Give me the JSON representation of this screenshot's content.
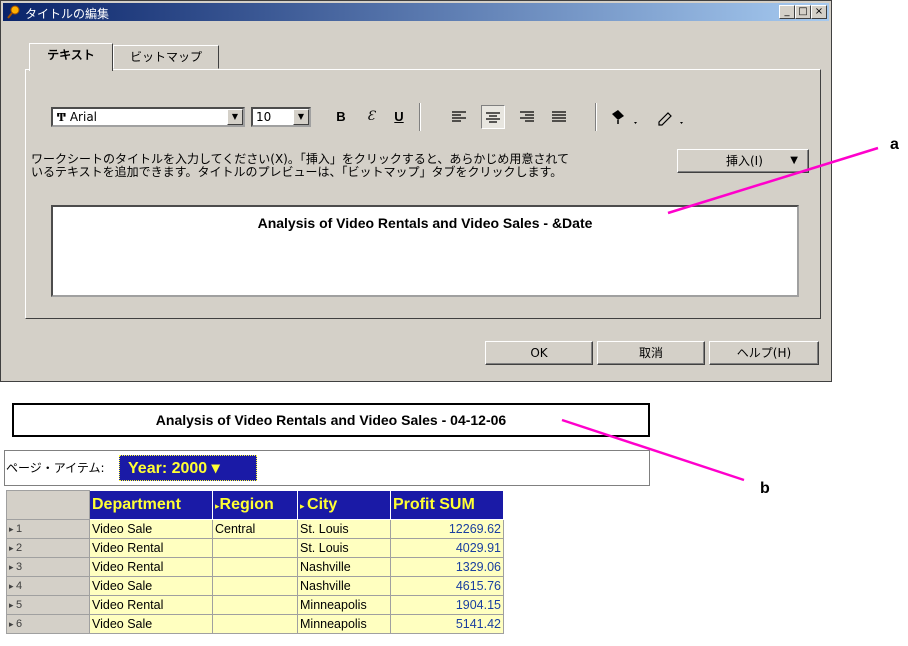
{
  "dialog": {
    "title": "タイトルの編集",
    "caption_buttons": {
      "minimize": "_",
      "maximize": "□",
      "close": "×"
    },
    "tabs": [
      {
        "label": "テキスト"
      },
      {
        "label": "ビットマップ"
      }
    ],
    "toolbar": {
      "font": "Arial",
      "font_icon": "Ͳ",
      "size": "10",
      "bold": "B",
      "italic": "Ɛ",
      "underline": "U"
    },
    "instructions": "ワークシートのタイトルを入力してください(X)。「挿入」をクリックすると、あらかじめ用意されて\nいるテキストを追加できます。タイトルのプレビューは、「ビットマップ」タブをクリックします。",
    "insert_button": "挿入(I)",
    "title_input": "Analysis of Video Rentals and Video Sales - &Date",
    "ok_button": "OK",
    "cancel_button": "取消",
    "help_button": "ヘルプ(H)"
  },
  "report": {
    "title": "Analysis of Video Rentals and Video Sales - 04-12-06",
    "page_items_label": "ページ・アイテム:",
    "page_item_value": "Year: 2000 ▾",
    "columns": [
      "Department",
      "Region",
      "City",
      "Profit SUM"
    ],
    "rows": [
      {
        "num": "1",
        "department": "Video Sale",
        "region": "Central",
        "city": "St. Louis",
        "profit": "12269.62"
      },
      {
        "num": "2",
        "department": "Video Rental",
        "region": "",
        "city": "St. Louis",
        "profit": "4029.91"
      },
      {
        "num": "3",
        "department": "Video Rental",
        "region": "",
        "city": "Nashville",
        "profit": "1329.06"
      },
      {
        "num": "4",
        "department": "Video Sale",
        "region": "",
        "city": "Nashville",
        "profit": "4615.76"
      },
      {
        "num": "5",
        "department": "Video Rental",
        "region": "",
        "city": "Minneapolis",
        "profit": "1904.15"
      },
      {
        "num": "6",
        "department": "Video Sale",
        "region": "",
        "city": "Minneapolis",
        "profit": "5141.42"
      }
    ]
  },
  "callouts": {
    "a": "a",
    "b": "b"
  },
  "colors": {
    "titlebar": "#0a246a",
    "header_bg": "#1a1aa6",
    "header_text": "#ffff33",
    "cell_bg": "#ffffc0",
    "callout_line": "#ff00cc"
  }
}
